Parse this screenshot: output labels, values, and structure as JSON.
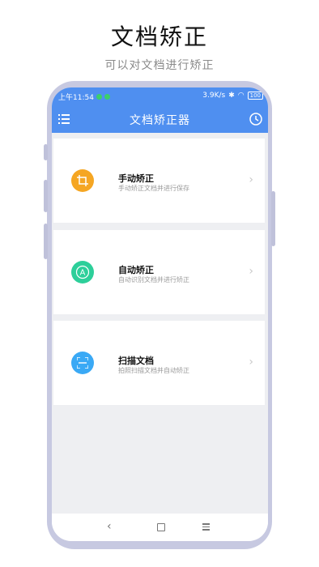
{
  "promo": {
    "title": "文档矫正",
    "subtitle": "可以对文档进行矫正"
  },
  "statusbar": {
    "time": "上午11:54",
    "speed": "3.9K/s",
    "battery": "100"
  },
  "appbar": {
    "title": "文档矫正器"
  },
  "cards": [
    {
      "title": "手动矫正",
      "desc": "手动矫正文档并进行保存",
      "icon": "crop-icon",
      "color": "#f5a623"
    },
    {
      "title": "自动矫正",
      "desc": "自动识别文档并进行矫正",
      "icon": "auto-a-icon",
      "color": "#2dcf9a"
    },
    {
      "title": "扫描文档",
      "desc": "拍照扫描文档并自动矫正",
      "icon": "scan-icon",
      "color": "#3aa9f5"
    }
  ],
  "colors": {
    "primary": "#4f8ff0",
    "frame": "#c7c9e1",
    "background": "#eeeff2"
  }
}
